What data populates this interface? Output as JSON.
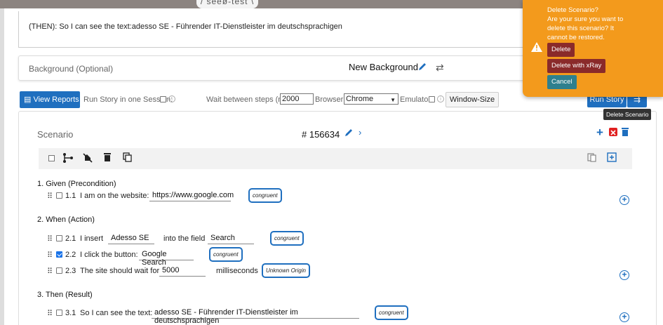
{
  "brand": {
    "logo_text": "seeø-test"
  },
  "then_preview": {
    "text": "(THEN): So I can see the text:adesso SE - Führender IT-Dienstleister im deutschsprachigen"
  },
  "background": {
    "label": "Background (Optional)",
    "name": "New Background"
  },
  "toolbar": {
    "view_reports": "View Reports",
    "run_story_one_session": "Run Story in one Session:",
    "wait_label": "Wait between steps (ms):",
    "wait_value": "2000",
    "browser_label": "Browser:",
    "browser_value": "Chrome",
    "emulator_label": "Emulator:",
    "window_size": "Window-Size",
    "run_story": "Run Story",
    "run_session_icon": "⇉"
  },
  "scenario": {
    "title": "Scenario",
    "id": "# 156634",
    "sections": [
      {
        "label": "1. Given (Precondition)",
        "steps": [
          {
            "num": "1.1",
            "text": "I am on the website:",
            "field1": "https://www.google.com",
            "mid": "",
            "field2": "",
            "badge": "congruent",
            "checked": false
          }
        ]
      },
      {
        "label": "2. When (Action)",
        "steps": [
          {
            "num": "2.1",
            "text": "I insert",
            "field1": "Adesso SE",
            "mid": "into the field",
            "field2": "Search",
            "badge": "congruent",
            "checked": false
          },
          {
            "num": "2.2",
            "text": "I click the button:",
            "field1": "Google Search",
            "mid": "",
            "field2": "",
            "badge": "congruent",
            "checked": true
          },
          {
            "num": "2.3",
            "text": "The site should wait for",
            "field1": "5000",
            "mid": "milliseconds",
            "field2": "",
            "badge": "Unknown Origin",
            "checked": false
          }
        ]
      },
      {
        "label": "3. Then (Result)",
        "steps": [
          {
            "num": "3.1",
            "text": "So I can see the text:",
            "field1": "adesso SE - Führender IT-Dienstleister im deutschsprachigen",
            "mid": "",
            "field2": "",
            "badge": "congruent",
            "checked": false
          }
        ]
      }
    ]
  },
  "popover": {
    "title": "Delete Scenario?",
    "message": "Are your sure you want to delete this scenario? It cannot be restored.",
    "delete": "Delete",
    "delete_xray": "Delete with xRay",
    "cancel": "Cancel"
  },
  "tooltip": {
    "text": "Delete Scenario"
  },
  "colors": {
    "accent": "#1f6fbf",
    "popover": "#f39a1c",
    "danger": "#8a2a2a",
    "cancel": "#2e7f8e"
  }
}
